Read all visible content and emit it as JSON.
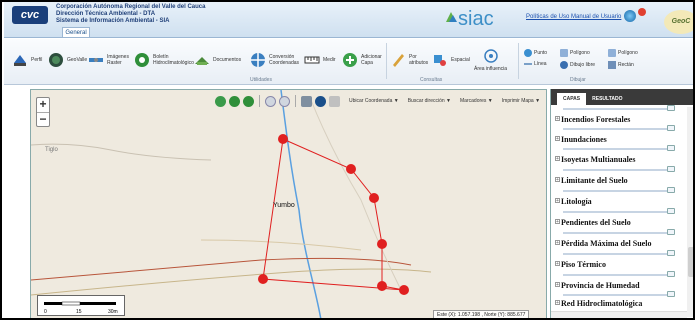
{
  "header": {
    "logo_text": "cvc",
    "org_line1": "Corporación Autónoma Regional del Valle del Cauca",
    "org_line2": "Dirección Técnica Ambiental - DTA",
    "org_line3": "Sistema de Información Ambiental - SIA",
    "tab_label": "General",
    "siac_label": "siac",
    "policy_link": "Políticas de Uso",
    "manual_link": "Manual de Usuario",
    "geo_label": "GeoC"
  },
  "ribbon": {
    "perfil": "Perfil",
    "geovalle": "GeoValle",
    "imagenes": "Imágenes Raster",
    "boletin": "Boletín Hidroclimatológico",
    "documentos": "Documentos",
    "conversion": "Conversión Coordenadas",
    "medir": "Medir",
    "adicionar": "Adicionar Capa",
    "por_atributos": "Por atributos",
    "espacial": "Espacial",
    "area_influencia": "Área influencia",
    "punto": "Punto",
    "linea": "Línea",
    "poligono": "Polígono",
    "dibujo_libre": "Dibujo libre",
    "poligono2": "Polígono",
    "rectangulo": "Rectán",
    "group_utilidades": "Utilidades",
    "group_consultas": "Consultas",
    "group_dibujar": "Dibujar"
  },
  "map_toolbar": {
    "ubicar": "Ubicar Coordenada",
    "buscar": "Buscar dirección",
    "marcadores": "Marcadores",
    "imprimir": "Imprimir Mapa"
  },
  "map": {
    "label_yumbo": "Yumbo",
    "label_tiglo": "Tiglo",
    "scale_labels": [
      "0",
      "15",
      "30m"
    ],
    "coords_text": "Este (X): 1.057.198 , Norte (Y): 885.677"
  },
  "panel": {
    "tab_capas": "CAPAS",
    "tab_resultado": "RESULTADO",
    "layers": [
      "Incendios Forestales",
      "Inundaciones",
      "Isoyetas Multianuales",
      "Limitante del Suelo",
      "Litología",
      "Pendientes del Suelo",
      "Pérdida Máxima del Suelo",
      "Piso Térmico",
      "Provincia de Humedad",
      "Red Hidroclimatológica"
    ]
  },
  "colors": {
    "accent": "#1a4f8a",
    "polygon": "#e02020",
    "panel_tabs": "#3a3a3a"
  }
}
